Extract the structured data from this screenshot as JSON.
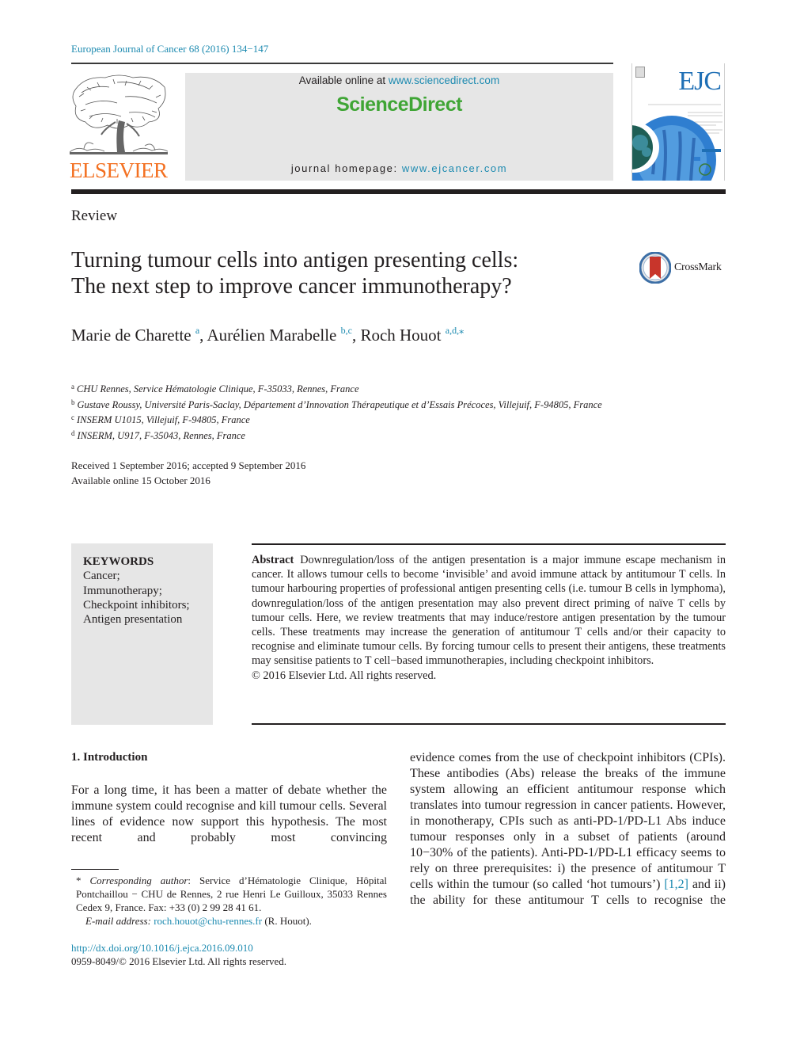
{
  "header": {
    "journal_ref": "European Journal of Cancer  68 (2016) 134−147",
    "publisher_name": "ELSEVIER",
    "available_online_prefix": "Available online at ",
    "available_online_link": "www.sciencedirect.com",
    "platform_name": "ScienceDirect",
    "homepage_prefix": "journal homepage: ",
    "homepage_link": "www.ejcancer.com",
    "cover_title": "EJC",
    "colors": {
      "link": "#1c8ab0",
      "elsevier_orange": "#f37021",
      "sciencedirect_green": "#3fa535",
      "banner_gray": "#e6e6e6"
    }
  },
  "article": {
    "type": "Review",
    "title_line1": "Turning tumour cells into antigen presenting cells:",
    "title_line2": "The next step to improve cancer immunotherapy?",
    "crossmark_label": "CrossMark",
    "authors": [
      {
        "name": "Marie de Charette",
        "sup": "a"
      },
      {
        "name": "Aurélien Marabelle",
        "sup": "b,c"
      },
      {
        "name": "Roch Houot",
        "sup": "a,d,⁎"
      }
    ],
    "affiliations": [
      {
        "key": "a",
        "text": "CHU Rennes, Service Hématologie Clinique, F-35033, Rennes, France"
      },
      {
        "key": "b",
        "text": "Gustave Roussy, Université Paris-Saclay, Département d’Innovation Thérapeutique et d’Essais Précoces, Villejuif, F-94805, France"
      },
      {
        "key": "c",
        "text": "INSERM U1015, Villejuif, F-94805, France"
      },
      {
        "key": "d",
        "text": "INSERM, U917, F-35043, Rennes, France"
      }
    ],
    "received": "Received 1 September 2016; accepted 9 September 2016",
    "available_online": "Available online 15 October 2016"
  },
  "keywords": {
    "heading": "KEYWORDS",
    "items": [
      "Cancer;",
      "Immunotherapy;",
      "Checkpoint inhibitors;",
      "Antigen presentation"
    ]
  },
  "abstract": {
    "label": "Abstract",
    "text": "Downregulation/loss of the antigen presentation is a major immune escape mechanism in cancer. It allows tumour cells to become ‘invisible’ and avoid immune attack by antitumour T cells. In tumour harbouring properties of professional antigen presenting cells (i.e. tumour B cells in lymphoma), downregulation/loss of the antigen presentation may also prevent direct priming of naïve T cells by tumour cells. Here, we review treatments that may induce/restore antigen presentation by the tumour cells. These treatments may increase the generation of antitumour T cells and/or their capacity to recognise and eliminate tumour cells. By forcing tumour cells to present their antigens, these treatments may sensitise patients to T cell−based immunotherapies, including checkpoint inhibitors.",
    "copyright": "© 2016 Elsevier Ltd. All rights reserved."
  },
  "body": {
    "section_heading": "1. Introduction",
    "left_paragraph": "For a long time, it has been a matter of debate whether the immune system could recognise and kill tumour cells. Several lines of evidence now support this hypothesis. The most recent and probably most convincing",
    "right_paragraph_before_ref": "evidence comes from the use of checkpoint inhibitors (CPIs). These antibodies (Abs) release the breaks of the immune system allowing an efficient antitumour response which translates into tumour regression in cancer patients. However, in monotherapy, CPIs such as anti-PD-1/PD-L1 Abs induce tumour responses only in a subset of patients (around 10−30% of the patients). Anti-PD-1/PD-L1 efficacy seems to rely on three prerequisites: i) the presence of antitumour T cells within the tumour (so called ‘hot tumours’) ",
    "right_paragraph_ref": "[1,2]",
    "right_paragraph_after_ref": " and ii) the ability for these antitumour T cells to recognise the"
  },
  "footnotes": {
    "corresponding_marker": "* ",
    "corresponding_label": "Corresponding author",
    "corresponding_text": ": Service d’Hématologie Clinique, Hôpital Pontchaillou − CHU de Rennes, 2 rue Henri Le Guilloux, 35033 Rennes Cedex 9, France. Fax: +33 (0) 2 99 28 41 61.",
    "email_label": "E-mail address:",
    "email": "roch.houot@chu-rennes.fr",
    "email_suffix": " (R. Houot).",
    "doi": "http://dx.doi.org/10.1016/j.ejca.2016.09.010",
    "issn_line": "0959-8049/© 2016 Elsevier Ltd. All rights reserved."
  }
}
